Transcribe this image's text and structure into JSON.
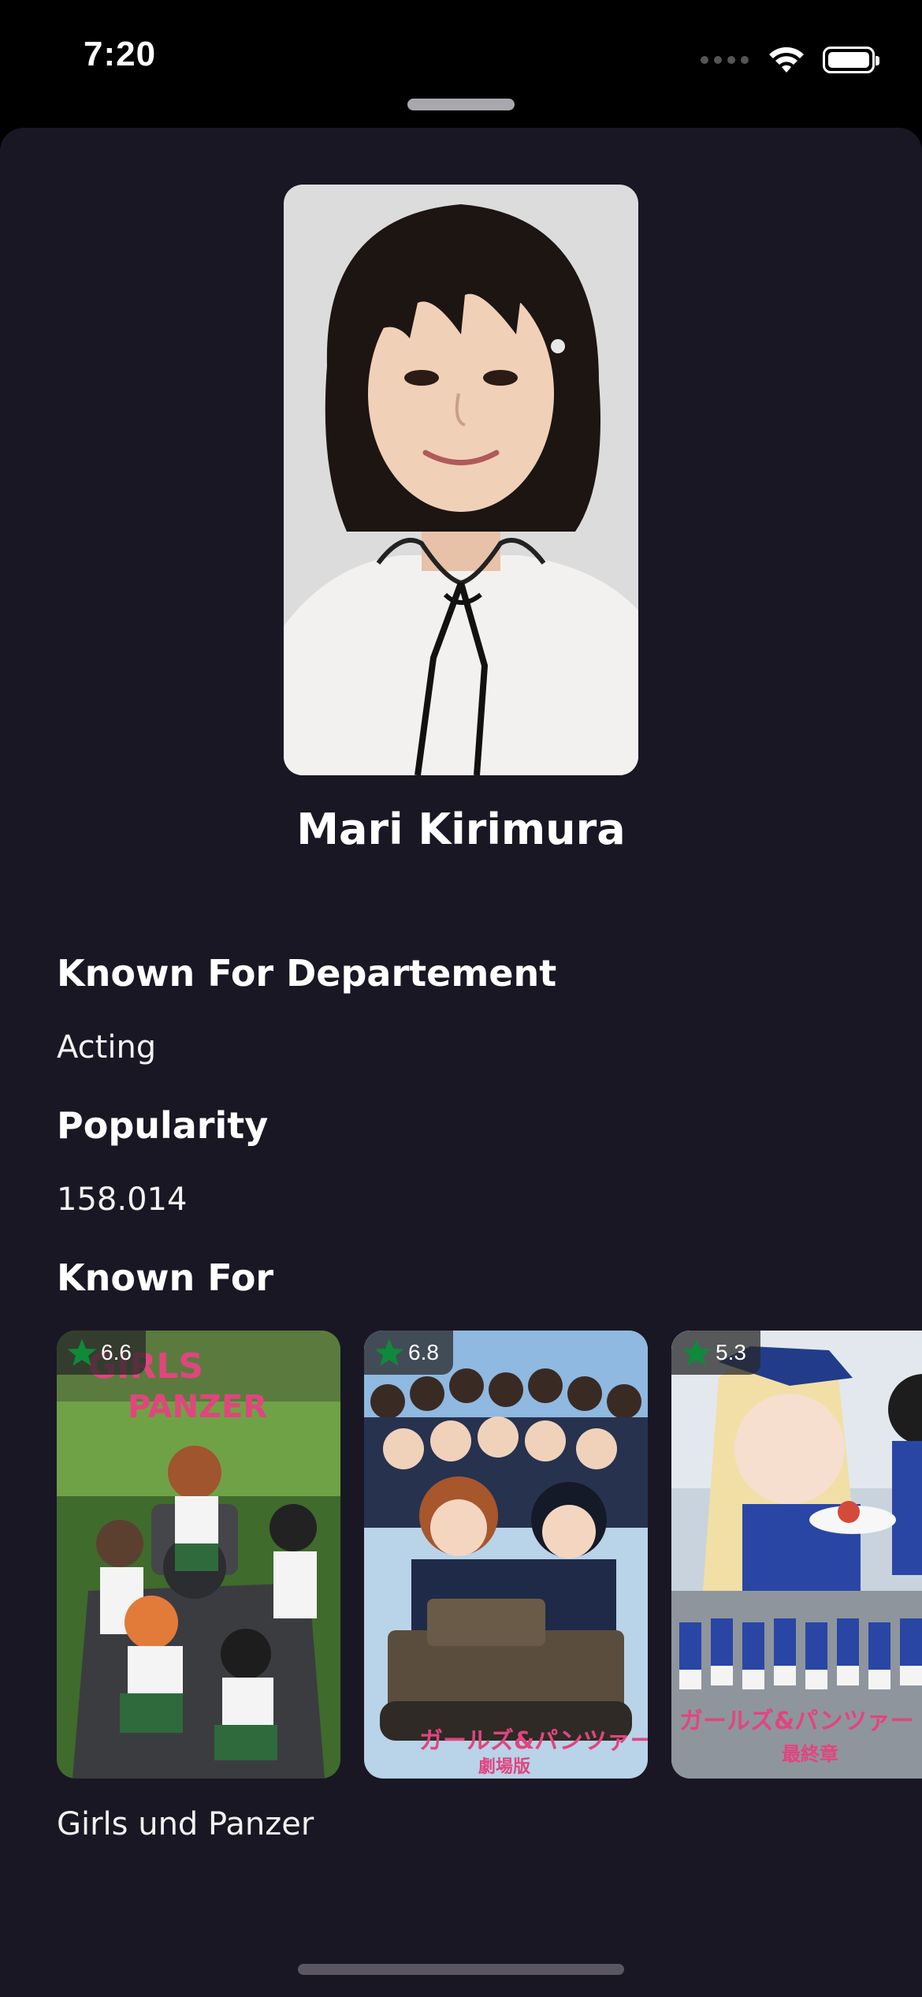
{
  "status_bar": {
    "time": "7:20"
  },
  "person": {
    "name": "Mari Kirimura"
  },
  "sections": {
    "department_title": "Known For Departement",
    "department_value": "Acting",
    "popularity_title": "Popularity",
    "popularity_value": "158.014",
    "known_for_title": "Known For"
  },
  "known_for": [
    {
      "rating": "6.6",
      "poster": "Girls und Panzer poster"
    },
    {
      "rating": "6.8",
      "poster": "Girls und Panzer der Film poster"
    },
    {
      "rating": "5.3",
      "poster": "Girls und Panzer das Finale poster"
    }
  ],
  "selected_title": "Girls und Panzer",
  "colors": {
    "background": "#1a1724",
    "star": "#0f8a3a",
    "text": "#ffffff"
  }
}
